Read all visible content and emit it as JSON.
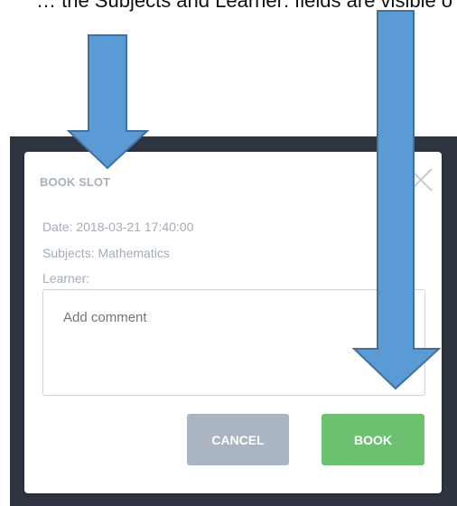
{
  "caption_fragment": "… the Subjects and Learner: fields are visible only …",
  "modal": {
    "title": "BOOK SLOT",
    "date_line": "Date: 2018-03-21 17:40:00",
    "subjects_line": "Subjects: Mathematics",
    "learner_line": "Learner:",
    "comment_placeholder": "Add comment",
    "cancel_label": "CANCEL",
    "book_label": "BOOK",
    "close_icon": "close-icon"
  },
  "colors": {
    "backdrop": "#2f3441",
    "title": "#a8b0bc",
    "cancel_button": "#abb4c1",
    "book_button": "#6cc070",
    "annotation_arrow": "#5b9bd5"
  },
  "annotations": {
    "arrows": [
      "down-arrow-icon",
      "down-arrow-icon"
    ]
  }
}
